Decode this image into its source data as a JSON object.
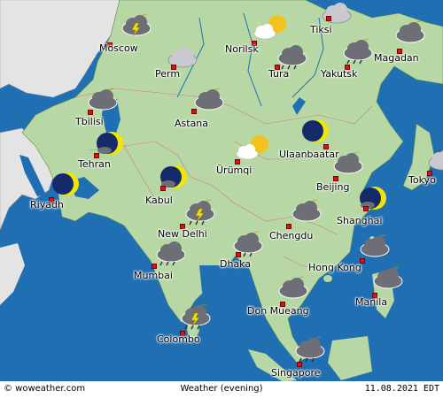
{
  "footer": {
    "brand": "© woweather.com",
    "title": "Weather (evening)",
    "date": "11.08.2021 EDT"
  },
  "colors": {
    "water": "#1f6fb2",
    "land": "#b7d8a4",
    "land_west": "#e4e4e4",
    "marker": "#e0101a"
  },
  "cities": [
    {
      "name": "Moscow",
      "icon": "thunderstorm-moon-icon"
    },
    {
      "name": "Norilsk",
      "icon": "partly-cloudy-sun-icon"
    },
    {
      "name": "Tiksi",
      "icon": "cloudy-icon"
    },
    {
      "name": "Perm",
      "icon": "cloudy-icon"
    },
    {
      "name": "Tura",
      "icon": "cloudy-rain-icon"
    },
    {
      "name": "Yakutsk",
      "icon": "cloudy-rain-moon-icon"
    },
    {
      "name": "Magadan",
      "icon": "cloudy-moon-icon"
    },
    {
      "name": "Tbilisi",
      "icon": "cloudy-moon-icon"
    },
    {
      "name": "Astana",
      "icon": "cloudy-moon-icon"
    },
    {
      "name": "Tehran",
      "icon": "partly-cloudy-moon-icon"
    },
    {
      "name": "Ulaanbaatar",
      "icon": "clear-moon-icon"
    },
    {
      "name": "Ürümqi",
      "icon": "partly-cloudy-sun-icon"
    },
    {
      "name": "Riyadh",
      "icon": "clear-moon-icon"
    },
    {
      "name": "Kabul",
      "icon": "partly-cloudy-moon-icon"
    },
    {
      "name": "Beijing",
      "icon": "cloudy-moon-icon"
    },
    {
      "name": "Tokyo",
      "icon": "cloudy-icon"
    },
    {
      "name": "Shanghai",
      "icon": "partly-cloudy-moon-icon"
    },
    {
      "name": "New Delhi",
      "icon": "thunderstorm-rain-icon"
    },
    {
      "name": "Chengdu",
      "icon": "cloudy-moon-icon"
    },
    {
      "name": "Dhaka",
      "icon": "cloudy-rain-moon-icon"
    },
    {
      "name": "Mumbai",
      "icon": "cloudy-rain-icon"
    },
    {
      "name": "Hong Kong",
      "icon": "cloudy-moon-icon"
    },
    {
      "name": "Manila",
      "icon": "cloudy-moon-icon"
    },
    {
      "name": "Don Mueang",
      "icon": "cloudy-moon-icon"
    },
    {
      "name": "Colombo",
      "icon": "thunderstorm-rain-icon"
    },
    {
      "name": "Singapore",
      "icon": "cloudy-rain-moon-icon"
    }
  ]
}
